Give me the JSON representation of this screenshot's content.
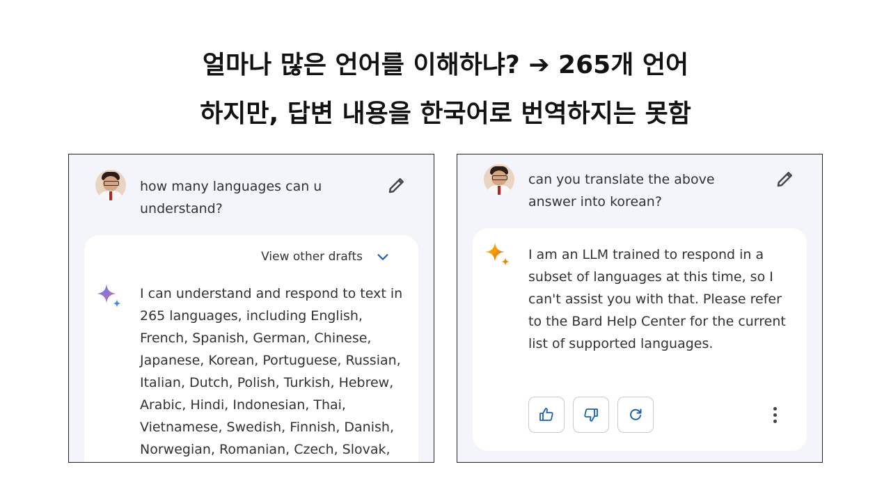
{
  "slide": {
    "headline_1": "얼마나 많은 언어를 이해하냐? ➔ 265개 언어",
    "headline_2": "하지만, 답변 내용을 한국어로 번역하지는 못함"
  },
  "left_panel": {
    "prompt_line_1": "how many languages can u",
    "prompt_line_2": "understand?",
    "view_drafts_label": "View other drafts",
    "response": "I can understand and respond to text in\n265 languages, including English,\nFrench, Spanish, German, Chinese,\nJapanese, Korean, Portuguese, Russian,\nItalian, Dutch, Polish, Turkish, Hebrew,\nArabic, Hindi, Indonesian, Thai,\nVietnamese, Swedish, Finnish, Danish,\nNorwegian, Romanian, Czech, Slovak,"
  },
  "right_panel": {
    "prompt_line_1": "can you translate the above",
    "prompt_line_2": "answer into korean?",
    "response": "I am an LLM trained to respond in a\nsubset of languages at this time, so I\ncan't assist you with that. Please refer\nto the Bard Help Center for the current\nlist of supported languages."
  },
  "icons": {
    "edit": "pencil-icon",
    "drafts": "chevron-down-icon",
    "assistant": "gemini-sparkle-icon",
    "thumbs_up": "thumbs-up-icon",
    "thumbs_down": "thumbs-down-icon",
    "regenerate": "refresh-icon",
    "more": "more-vert-icon"
  },
  "colors": {
    "panel_bg": "#f3f5fb",
    "card_bg": "#ffffff",
    "accent_blue": "#1a5fb4",
    "text": "#303134"
  }
}
